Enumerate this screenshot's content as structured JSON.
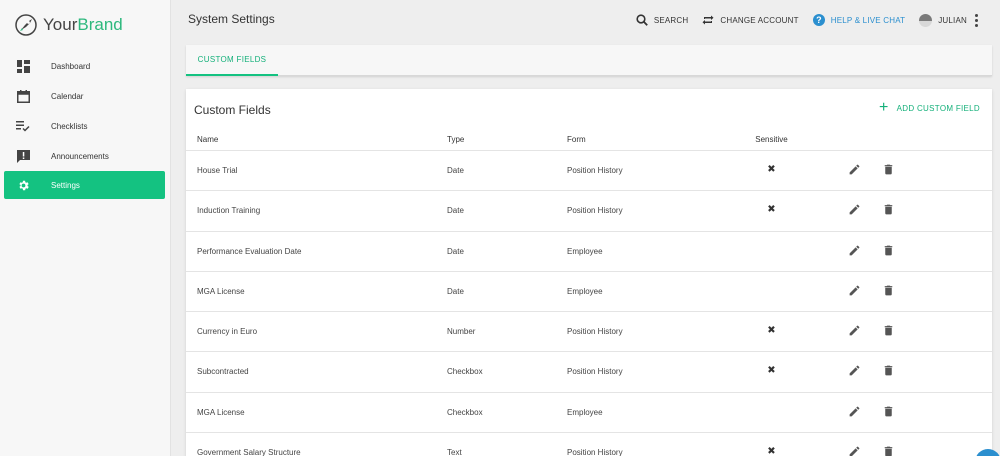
{
  "brand": {
    "name_part1": "Your",
    "name_part2": "Brand",
    "accent_color": "#2db87d"
  },
  "sidebar": {
    "items": [
      {
        "label": "Dashboard",
        "icon": "dashboard-icon",
        "active": false
      },
      {
        "label": "Calendar",
        "icon": "calendar-icon",
        "active": false
      },
      {
        "label": "Checklists",
        "icon": "checklist-icon",
        "active": false
      },
      {
        "label": "Announcements",
        "icon": "announcement-icon",
        "active": false
      },
      {
        "label": "Settings",
        "icon": "gear-icon",
        "active": true
      }
    ],
    "active_color": "#14c281"
  },
  "header": {
    "title": "System Settings",
    "search_label": "SEARCH",
    "change_account_label": "CHANGE ACCOUNT",
    "help_label": "HELP & LIVE CHAT",
    "user_label": "JULIAN",
    "help_color": "#2b8fcf"
  },
  "tabs": [
    {
      "label": "CUSTOM FIELDS",
      "active": true
    }
  ],
  "card": {
    "title": "Custom Fields",
    "add_label": "ADD CUSTOM FIELD"
  },
  "table": {
    "columns": {
      "name": "Name",
      "type": "Type",
      "form": "Form",
      "sensitive": "Sensitive"
    },
    "rows": [
      {
        "name": "House Trial",
        "type": "Date",
        "form": "Position History",
        "sensitive": "✖"
      },
      {
        "name": "Induction Training",
        "type": "Date",
        "form": "Position History",
        "sensitive": "✖"
      },
      {
        "name": "Performance Evaluation Date",
        "type": "Date",
        "form": "Employee",
        "sensitive": ""
      },
      {
        "name": "MGA License",
        "type": "Date",
        "form": "Employee",
        "sensitive": ""
      },
      {
        "name": "Currency in Euro",
        "type": "Number",
        "form": "Position History",
        "sensitive": "✖"
      },
      {
        "name": "Subcontracted",
        "type": "Checkbox",
        "form": "Position History",
        "sensitive": "✖"
      },
      {
        "name": "MGA License",
        "type": "Checkbox",
        "form": "Employee",
        "sensitive": ""
      },
      {
        "name": "Government Salary Structure",
        "type": "Text",
        "form": "Position History",
        "sensitive": "✖"
      }
    ]
  }
}
